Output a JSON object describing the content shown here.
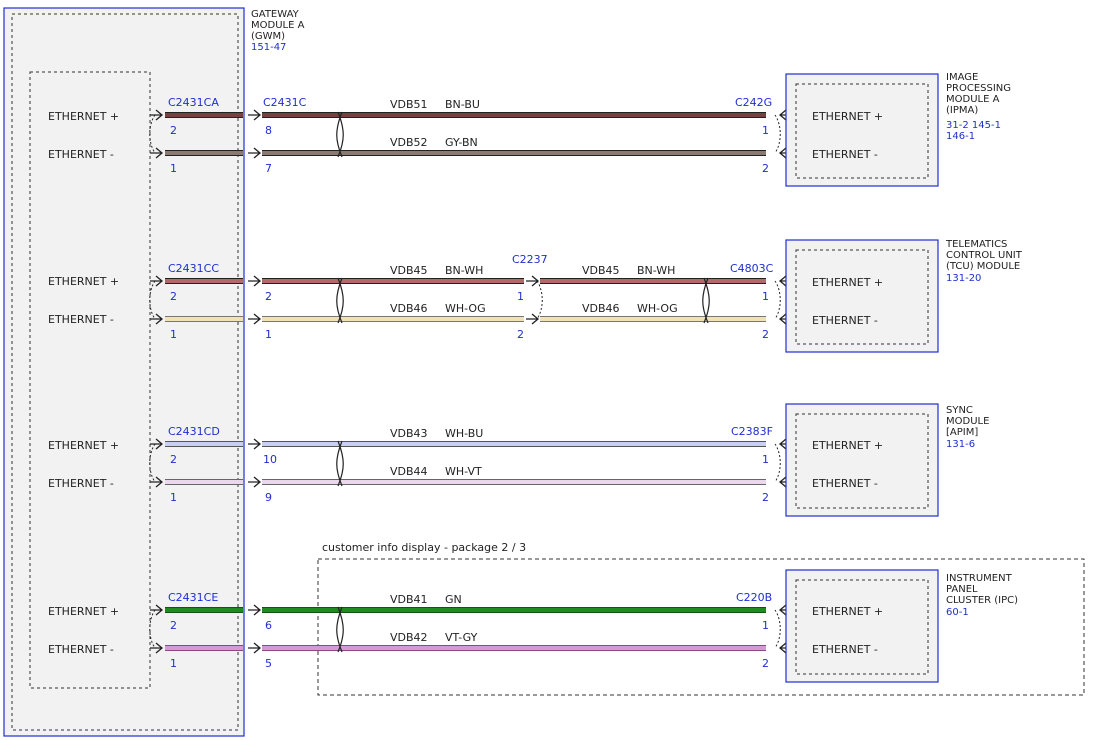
{
  "colors": {
    "connector_blue": "#1f2fd0",
    "text": "#222222",
    "module_fill": "#f2f2f2",
    "wire_BN_BU": "#7a3f3f",
    "wire_GY_BN": "#8a7a72",
    "wire_BN_WH": "#b06a6a",
    "wire_WH_OG": "#f2e0b8",
    "wire_WH_BU": "#c9cff4",
    "wire_WH_VT": "#ecd8ec",
    "wire_GN": "#1f8a1f",
    "wire_VT_GY": "#d49ad4"
  },
  "gateway": {
    "title_line1": "GATEWAY",
    "title_line2": "MODULE A",
    "title_line3": "(GWM)",
    "ref": "151-47"
  },
  "gwm_pins": [
    {
      "label": "ETHERNET +"
    },
    {
      "label": "ETHERNET -"
    },
    {
      "label": "ETHERNET +"
    },
    {
      "label": "ETHERNET -"
    },
    {
      "label": "ETHERNET +"
    },
    {
      "label": "ETHERNET -"
    },
    {
      "label": "ETHERNET +"
    },
    {
      "label": "ETHERNET -"
    }
  ],
  "circuits": [
    {
      "gwm_connector": "C2431CA",
      "gwm_pin_plus": "2",
      "gwm_pin_minus": "1",
      "inline_connector": "C2431C",
      "inline_pin_plus": "8",
      "inline_pin_minus": "7",
      "wire_plus": {
        "circuit": "VDB51",
        "color": "BN-BU"
      },
      "wire_minus": {
        "circuit": "VDB52",
        "color": "GY-BN"
      },
      "module_connector": "C242G",
      "module_pin_plus": "1",
      "module_pin_minus": "2",
      "module_title": [
        "IMAGE",
        "PROCESSING",
        "MODULE A",
        "(IPMA)"
      ],
      "module_refs": [
        "31-2  145-1",
        "146-1"
      ],
      "module_pin_labels": [
        "ETHERNET +",
        "ETHERNET -"
      ]
    },
    {
      "gwm_connector": "C2431CC",
      "gwm_pin_plus": "2",
      "gwm_pin_minus": "1",
      "inline_pin_plus": "2",
      "inline_pin_minus": "1",
      "wire_plus": {
        "circuit": "VDB45",
        "color": "BN-WH"
      },
      "wire_minus": {
        "circuit": "VDB46",
        "color": "WH-OG"
      },
      "splice_connector": "C2237",
      "splice_pin_plus": "1",
      "splice_pin_minus": "2",
      "wire2_plus": {
        "circuit": "VDB45",
        "color": "BN-WH"
      },
      "wire2_minus": {
        "circuit": "VDB46",
        "color": "WH-OG"
      },
      "module_connector": "C4803C",
      "module_pin_plus": "1",
      "module_pin_minus": "2",
      "module_title": [
        "TELEMATICS",
        "CONTROL UNIT",
        "(TCU) MODULE"
      ],
      "module_refs": [
        "131-20"
      ],
      "module_pin_labels": [
        "ETHERNET +",
        "ETHERNET -"
      ]
    },
    {
      "gwm_connector": "C2431CD",
      "gwm_pin_plus": "2",
      "gwm_pin_minus": "1",
      "inline_pin_plus": "10",
      "inline_pin_minus": "9",
      "wire_plus": {
        "circuit": "VDB43",
        "color": "WH-BU"
      },
      "wire_minus": {
        "circuit": "VDB44",
        "color": "WH-VT"
      },
      "module_connector": "C2383F",
      "module_pin_plus": "1",
      "module_pin_minus": "2",
      "module_title": [
        "SYNC",
        "MODULE",
        "[APIM]"
      ],
      "module_refs": [
        "131-6"
      ],
      "module_pin_labels": [
        "ETHERNET +",
        "ETHERNET -"
      ]
    },
    {
      "gwm_connector": "C2431CE",
      "gwm_pin_plus": "2",
      "gwm_pin_minus": "1",
      "inline_pin_plus": "6",
      "inline_pin_minus": "5",
      "wire_plus": {
        "circuit": "VDB41",
        "color": "GN"
      },
      "wire_minus": {
        "circuit": "VDB42",
        "color": "VT-GY"
      },
      "module_connector": "C220B",
      "module_pin_plus": "1",
      "module_pin_minus": "2",
      "module_title": [
        "INSTRUMENT",
        "PANEL",
        "CLUSTER (IPC)"
      ],
      "module_refs": [
        "60-1"
      ],
      "module_pin_labels": [
        "ETHERNET +",
        "ETHERNET -"
      ]
    }
  ],
  "option_box": {
    "label": "customer info display - package 2 / 3"
  }
}
